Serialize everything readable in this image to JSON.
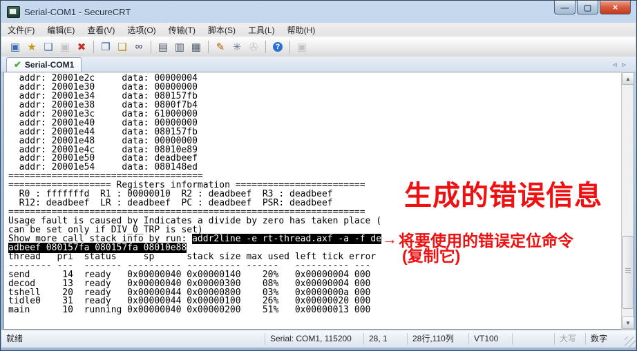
{
  "window": {
    "title": "Serial-COM1 - SecureCRT",
    "controls": [
      {
        "name": "minimize-button",
        "glyph": "—"
      },
      {
        "name": "maximize-button",
        "glyph": "▢"
      },
      {
        "name": "close-button",
        "glyph": "×"
      }
    ]
  },
  "menu": {
    "items": [
      {
        "key": "file",
        "label": "文件(F)"
      },
      {
        "key": "edit",
        "label": "编辑(E)"
      },
      {
        "key": "view",
        "label": "查看(V)"
      },
      {
        "key": "options",
        "label": "选项(O)"
      },
      {
        "key": "transfer",
        "label": "传输(T)"
      },
      {
        "key": "script",
        "label": "脚本(S)"
      },
      {
        "key": "tools",
        "label": "工具(L)"
      },
      {
        "key": "help",
        "label": "帮助(H)"
      }
    ]
  },
  "toolbar": {
    "buttons": [
      {
        "name": "connect-icon",
        "glyph": "▣",
        "color": "#3c6eaa"
      },
      {
        "name": "quick-connect-icon",
        "glyph": "★",
        "color": "#c79810"
      },
      {
        "name": "connect-in-tab-icon",
        "glyph": "❏",
        "color": "#3c6eaa"
      },
      {
        "name": "reconnect-icon",
        "glyph": "▣",
        "color": "#9aa4ae",
        "disabled": true
      },
      {
        "name": "disconnect-icon",
        "glyph": "✖",
        "color": "#c23227"
      },
      {
        "sep": true
      },
      {
        "name": "copy-icon",
        "glyph": "❐",
        "color": "#2a5caa"
      },
      {
        "name": "paste-icon",
        "glyph": "❑",
        "color": "#b8860b"
      },
      {
        "name": "find-icon",
        "glyph": "∞",
        "color": "#31435c"
      },
      {
        "sep": true
      },
      {
        "name": "log-session-icon",
        "glyph": "▤",
        "color": "#4d5a6b"
      },
      {
        "name": "raw-log-icon",
        "glyph": "▥",
        "color": "#4d5a6b"
      },
      {
        "name": "print-icon",
        "glyph": "▦",
        "color": "#4d5a6b"
      },
      {
        "sep": true
      },
      {
        "name": "session-options-icon",
        "glyph": "✎",
        "color": "#b06000"
      },
      {
        "name": "global-options-icon",
        "glyph": "✳",
        "color": "#6b7b8d"
      },
      {
        "name": "key-icon",
        "glyph": "✇",
        "color": "#9aa4ae",
        "disabled": true
      },
      {
        "sep": true
      },
      {
        "name": "help-icon",
        "glyph": "?",
        "color": "#ffffff"
      },
      {
        "sep": true
      },
      {
        "name": "session-manager-icon",
        "glyph": "▣",
        "color": "#9aa4ae",
        "disabled": true
      }
    ]
  },
  "tabbar": {
    "tabs": [
      {
        "label": "Serial-COM1",
        "icon": "✔"
      }
    ],
    "prev": "◃",
    "next": "▹"
  },
  "terminal": {
    "lines": [
      "  addr: 20001e2c     data: 00000004",
      "  addr: 20001e30     data: 00000000",
      "  addr: 20001e34     data: 080157fb",
      "  addr: 20001e38     data: 0800f7b4",
      "  addr: 20001e3c     data: 61000000",
      "  addr: 20001e40     data: 00000000",
      "  addr: 20001e44     data: 080157fb",
      "  addr: 20001e48     data: 00000000",
      "  addr: 20001e4c     data: 08010e89",
      "  addr: 20001e50     data: deadbeef",
      "  addr: 20001e54     data: 080148ed",
      "====================================",
      "=================== Registers information ========================",
      "  R0 : fffffffd  R1 : 00000010  R2 : deadbeef  R3 : deadbeef",
      "  R12: deadbeef  LR : deadbeef  PC : deadbeef  PSR: deadbeef",
      "==================================================================",
      "Usage fault is caused by Indicates a divide by zero has taken place (",
      "can be set only if DIV_0_TRP is set)",
      [
        [
          "Show more call stack info by run: ",
          0
        ],
        [
          "addr2line -e rt-thread.axf -a -f de",
          1
        ]
      ],
      [
        [
          "adbeef 080157fa 080157fa 08010e88",
          1
        ]
      ],
      "thread   pri  status     sp      stack size max used left tick error",
      "-------- ---  ------- ---------- ---------- ------   ---------- ---",
      "send      14  ready   0x00000040 0x00000140    20%   0x00000004 000",
      "decod     13  ready   0x00000040 0x00000300    08%   0x00000004 000",
      "tshell    20  ready   0x00000044 0x00000800    03%   0x0000000a 000",
      "tidle0    31  ready   0x00000044 0x00000100    26%   0x00000020 000",
      "main      10  running 0x00000040 0x00000200    51%   0x00000013 000"
    ]
  },
  "scrollbar": {
    "up": "▲",
    "down": "▼"
  },
  "annotations": {
    "title": "生成的错误信息",
    "arrow": "→",
    "label_line1": "将要使用的错误定位命令",
    "label_line2": "(复制它)",
    "color": "#ee1111"
  },
  "statusbar": {
    "segments": [
      {
        "name": "status-ready",
        "label": "就绪",
        "first": true
      },
      {
        "name": "status-serial",
        "label": "Serial: COM1, 115200"
      },
      {
        "name": "status-cursor",
        "label": "28, 1"
      },
      {
        "name": "status-size",
        "label": "28行,110列"
      },
      {
        "name": "status-emulation",
        "label": "VT100"
      },
      {
        "name": "status-blank",
        "label": ""
      },
      {
        "name": "status-caps",
        "label": "大写",
        "dim": true
      },
      {
        "name": "status-num",
        "label": "数字"
      }
    ]
  }
}
